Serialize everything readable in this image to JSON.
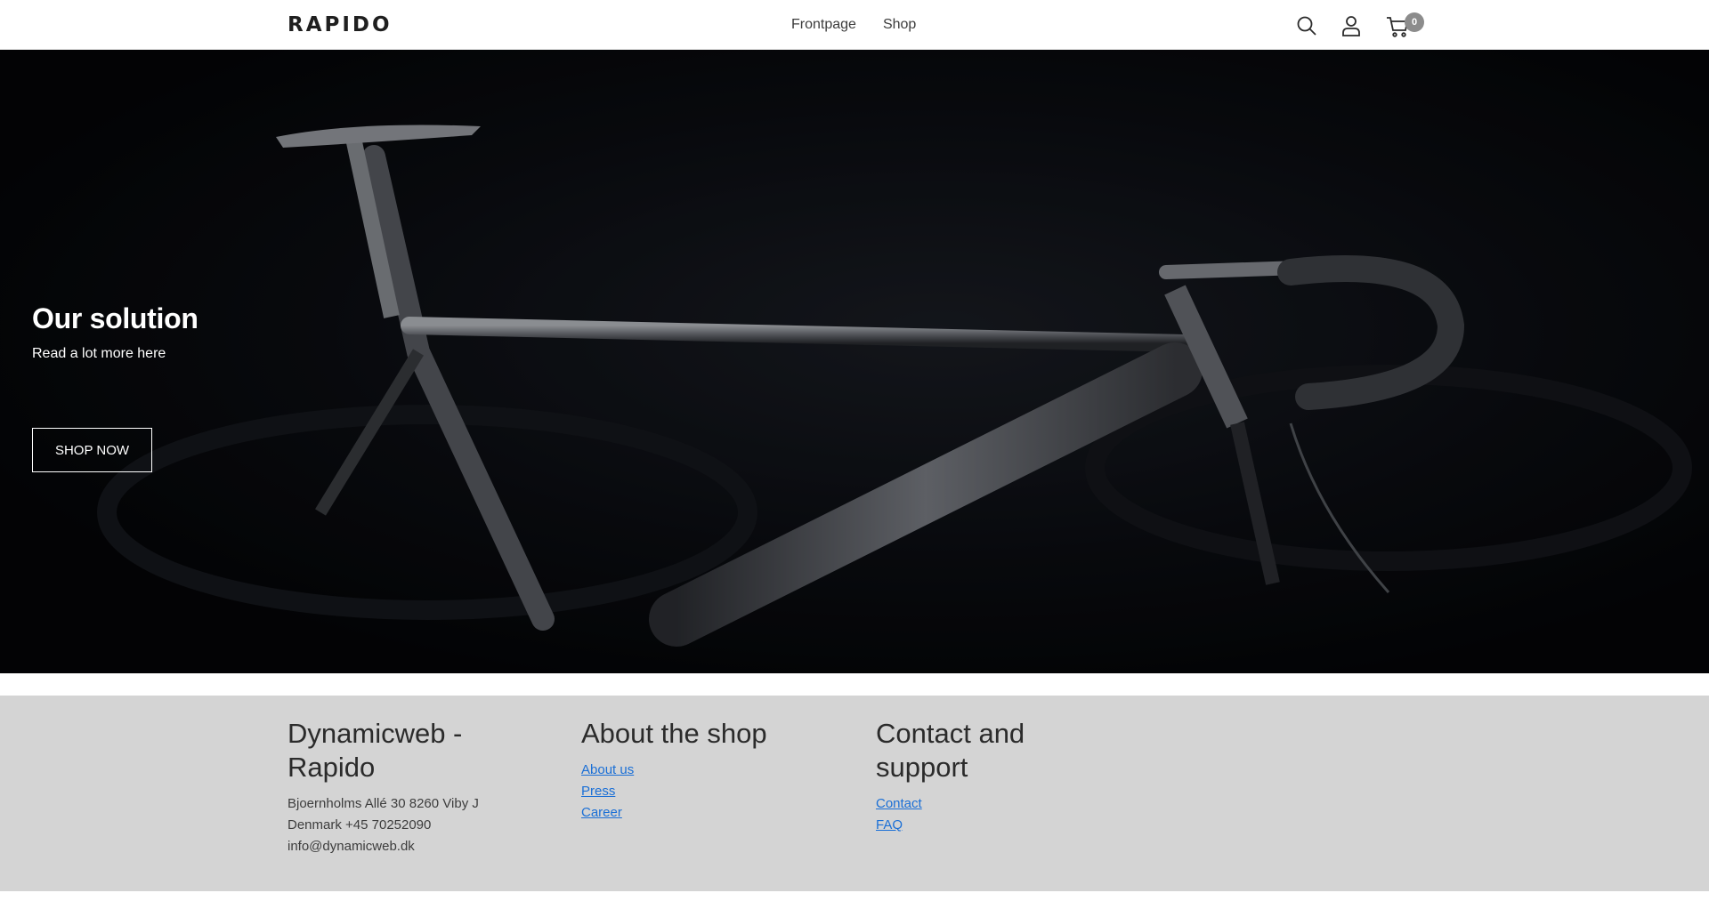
{
  "header": {
    "logo": "RAPIDO",
    "nav": [
      {
        "label": "Frontpage"
      },
      {
        "label": "Shop"
      }
    ],
    "cart_count": "0",
    "icons": [
      "search-icon",
      "user-icon",
      "cart-icon"
    ]
  },
  "hero": {
    "title": "Our solution",
    "subtitle": "Read a lot more here",
    "button_label": "SHOP NOW"
  },
  "footer": {
    "company": {
      "title": "Dynamicweb - Rapido",
      "address_line1": "Bjoernholms Allé 30 8260 Viby J",
      "address_line2": "Denmark +45 70252090",
      "email": "info@dynamicweb.dk"
    },
    "about": {
      "title": "About the shop",
      "links": [
        {
          "label": "About us"
        },
        {
          "label": "Press"
        },
        {
          "label": "Career"
        }
      ]
    },
    "contact": {
      "title": "Contact and support",
      "links": [
        {
          "label": "Contact"
        },
        {
          "label": "FAQ"
        }
      ]
    }
  },
  "colors": {
    "header_bg": "#ffffff",
    "hero_bg": "#06070b",
    "footer_bg": "#d4d4d4",
    "link": "#1a6fd6",
    "badge": "#8c8c8c"
  }
}
